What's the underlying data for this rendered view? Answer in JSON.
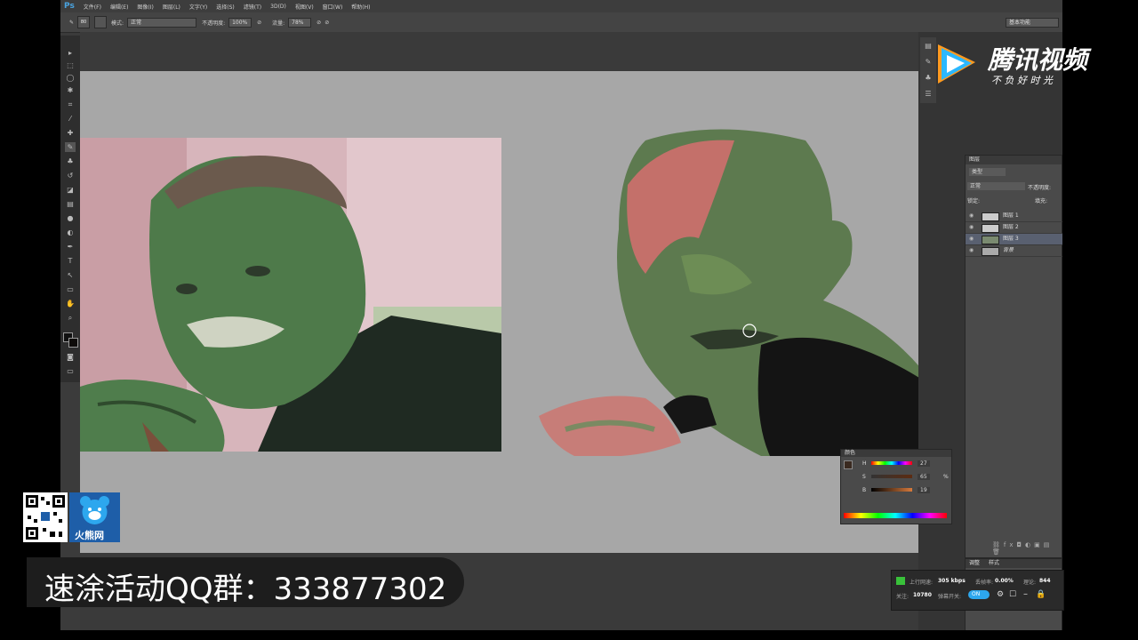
{
  "app": {
    "logo": "Ps",
    "menu": [
      "文件(F)",
      "编辑(E)",
      "图像(I)",
      "图层(L)",
      "文字(Y)",
      "选择(S)",
      "滤镜(T)",
      "3D(D)",
      "视图(V)",
      "窗口(W)",
      "帮助(H)"
    ]
  },
  "options": {
    "brush_size": "80",
    "mode_label": "模式:",
    "mode_value": "正常",
    "opacity_label": "不透明度:",
    "opacity_value": "100%",
    "flow_label": "流量:",
    "flow_value": "78%",
    "workspace": "基本功能"
  },
  "layers_panel": {
    "tab": "图层",
    "kind": "类型",
    "blend": "正常",
    "opacity_label": "不透明度:",
    "lock_label": "锁定:",
    "fill_label": "填充:",
    "layers": [
      {
        "name": "图层 1"
      },
      {
        "name": "图层 2"
      },
      {
        "name": "图层 3"
      },
      {
        "name": "背景"
      }
    ],
    "adjust_tabs": [
      "调整",
      "样式"
    ]
  },
  "color_panel": {
    "tab": "颜色",
    "h_label": "H",
    "h_value": "27",
    "s_label": "S",
    "s_value": "65",
    "b_label": "B",
    "b_value": "19",
    "pct": "%"
  },
  "watermark": {
    "brand": "腾讯视频",
    "slogan": "不 负 好 时 光"
  },
  "promo": {
    "site": "火熊网",
    "banner": "速涂活动QQ群：333877302"
  },
  "stream": {
    "upload_label": "上行网速:",
    "upload_value": "305 kbps",
    "loss_label": "丢帧率:",
    "loss_value": "0.00%",
    "delay_label": "理论:",
    "delay_value": "844",
    "follow_label": "关注:",
    "follow_value": "10780",
    "bullet_label": "弹幕开关:",
    "toggle": "ON"
  }
}
